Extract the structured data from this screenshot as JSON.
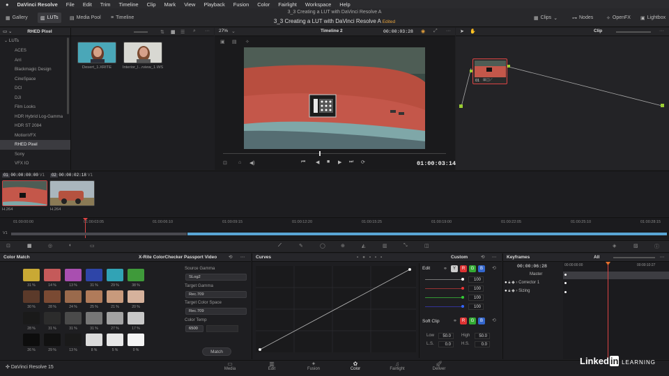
{
  "menubar": {
    "app": "DaVinci Resolve",
    "items": [
      "File",
      "Edit",
      "Trim",
      "Timeline",
      "Clip",
      "Mark",
      "View",
      "Playback",
      "Fusion",
      "Color",
      "Fairlight",
      "Workspace",
      "Help"
    ]
  },
  "toolbar": {
    "gallery": "Gallery",
    "luts": "LUTs",
    "media_pool": "Media Pool",
    "timeline": "Timeline",
    "project_top": "3_3 Creating a LUT with DaVinci Resolve A",
    "project_title": "3_3 Creating a LUT with DaVinci Resolve A",
    "edited": "Edited",
    "clips": "Clips",
    "nodes": "Nodes",
    "openfx": "OpenFX",
    "lightbox": "Lightbox"
  },
  "lut_panel": {
    "header": "RHED Pixel",
    "root": "LUTs",
    "items": [
      "ACES",
      "Arri",
      "Blackmagic Design",
      "CineSpace",
      "DCI",
      "DJI",
      "Film Looks",
      "HDR Hybrid Log-Gamma",
      "HDR ST 2084",
      "MotionVFX",
      "RHED Pixel",
      "Sony",
      "VFX IO"
    ],
    "selected": "RHED Pixel",
    "thumbs": [
      "Desert_1.XRITE",
      "Interior_l...rview_1.WS"
    ]
  },
  "viewer": {
    "zoom": "27%",
    "timeline": "Timeline 2",
    "tc_top": "00:00:03:28",
    "mode": "Clip",
    "timecode": "01:00:03:14"
  },
  "clips": [
    {
      "num": "01",
      "tc": "00:00:00:00",
      "track": "V1",
      "codec": "H.264"
    },
    {
      "num": "02",
      "tc": "00:00:02:18",
      "track": "V1",
      "codec": "H.264"
    }
  ],
  "ruler": [
    "01:00:00:00",
    "01:00:03:05",
    "01:00:06:10",
    "01:00:09:15",
    "01:00:12:20",
    "01:00:15:25",
    "01:00:19:00",
    "01:00:22:05",
    "01:00:25:10",
    "01:00:28:15"
  ],
  "track_label": "V1",
  "node": {
    "label": "01"
  },
  "color_match": {
    "title": "Color Match",
    "chart": "X-Rite ColorChecker Passport Video",
    "rows": [
      [
        {
          "c": "#c9a934",
          "p": "31 %"
        },
        {
          "c": "#c55a5a",
          "p": "14 %"
        },
        {
          "c": "#a94fb0",
          "p": "13 %"
        },
        {
          "c": "#2e45a8",
          "p": "31 %"
        },
        {
          "c": "#31a3b5",
          "p": "29 %"
        },
        {
          "c": "#3f9a3a",
          "p": "38 %"
        }
      ],
      [
        {
          "c": "#5b3a2a",
          "p": "30 %"
        },
        {
          "c": "#7a4a33",
          "p": "28 %"
        },
        {
          "c": "#9a6a4c",
          "p": "24 %"
        },
        {
          "c": "#b07b5a",
          "p": "25 %"
        },
        {
          "c": "#c89a7c",
          "p": "21 %"
        },
        {
          "c": "#d6b29c",
          "p": "20 %"
        }
      ],
      [
        {
          "c": "#1a1a1a",
          "p": "28 %"
        },
        {
          "c": "#2c2c2c",
          "p": "31 %"
        },
        {
          "c": "#4a4a4a",
          "p": "31 %"
        },
        {
          "c": "#777777",
          "p": "31 %"
        },
        {
          "c": "#a3a3a3",
          "p": "27 %"
        },
        {
          "c": "#c8c8c8",
          "p": "17 %"
        }
      ],
      [
        {
          "c": "#0d0d0d",
          "p": "26 %"
        },
        {
          "c": "#111111",
          "p": "29 %"
        },
        {
          "c": "#1a1a1a",
          "p": "13 %"
        },
        {
          "c": "#dcdcdc",
          "p": "8 %"
        },
        {
          "c": "#e8e8e8",
          "p": "5 %"
        },
        {
          "c": "#f4f4f4",
          "p": "0 %"
        }
      ]
    ],
    "source_gamma_label": "Source Gamma",
    "source_gamma": "SLog2",
    "target_gamma_label": "Target Gamma",
    "target_gamma": "Rec.709",
    "target_cs_label": "Target Color Space",
    "target_cs": "Rec.709",
    "temp_label": "Color Temp",
    "temp": "6500",
    "match": "Match"
  },
  "curves": {
    "title": "Curves",
    "preset": "Custom",
    "edit": "Edit",
    "vals": [
      "100",
      "100",
      "100",
      "100"
    ],
    "soft_clip": "Soft Clip",
    "low": "Low",
    "low_v": "50.0",
    "high": "High",
    "high_v": "50.0",
    "ls": "L.S.",
    "ls_v": "0.0",
    "hs": "H.S.",
    "hs_v": "0.0"
  },
  "keyframes": {
    "title": "Keyframes",
    "filter": "All",
    "tc": "00:00:06:28",
    "start": "00:00:00:00",
    "end": "00:00:10:27",
    "rows": [
      "Master",
      "Corrector 1",
      "Sizing"
    ]
  },
  "nav": [
    "Media",
    "Edit",
    "Fusion",
    "Color",
    "Fairlight",
    "Deliver"
  ],
  "brand": "DaVinci Resolve 15",
  "linkedin": {
    "a": "Linked",
    "b": "in",
    "c": "LEARNING"
  }
}
